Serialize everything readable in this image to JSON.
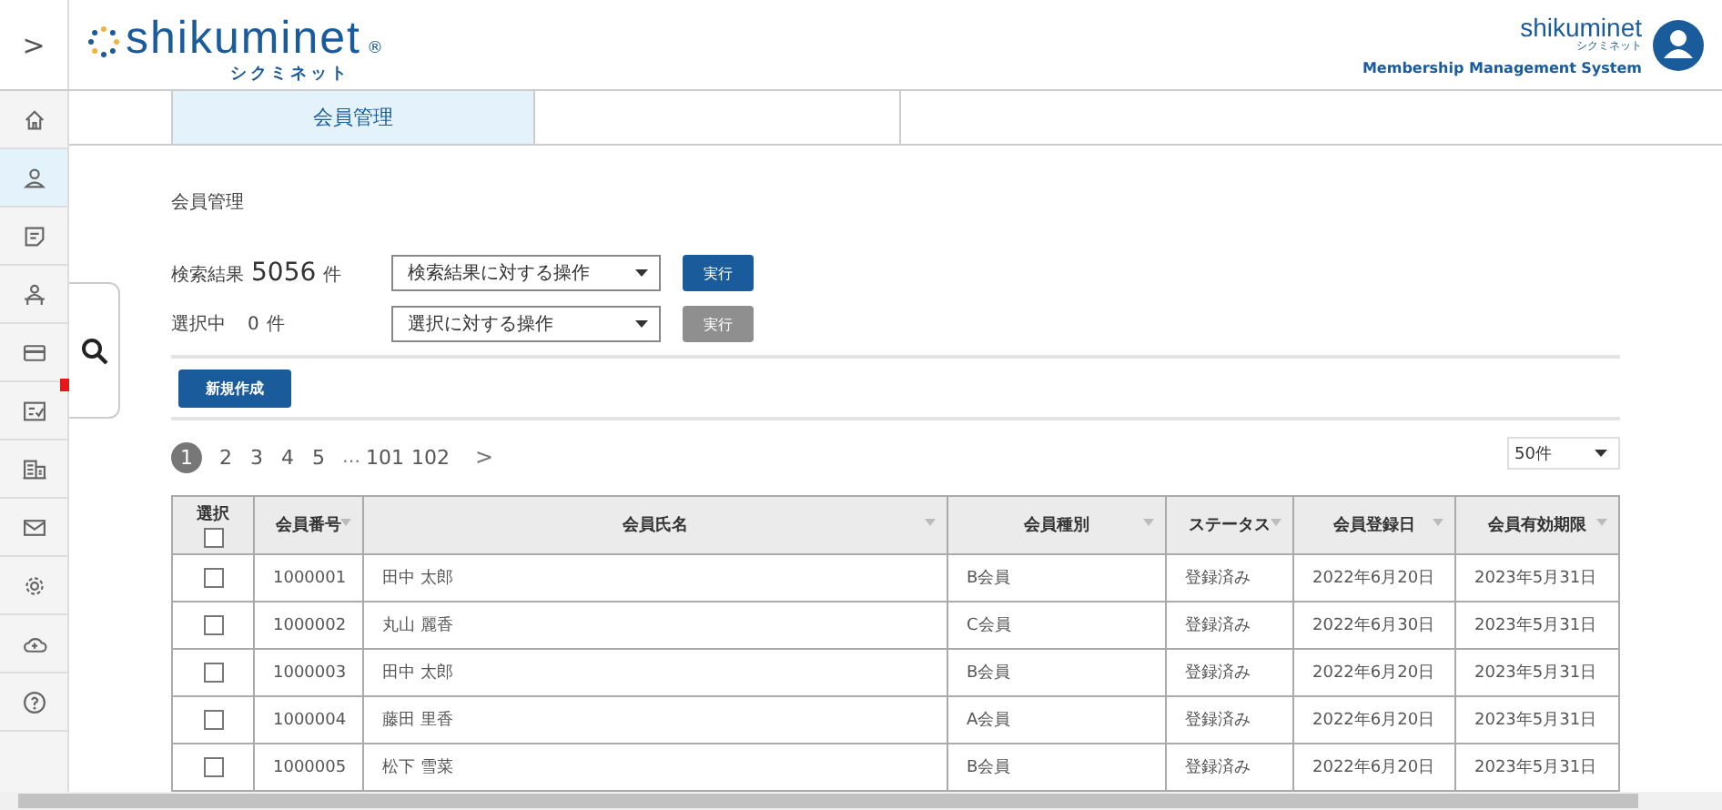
{
  "header": {
    "expand": ">",
    "logo": {
      "name": "shikuminet",
      "mark": "®",
      "kana": "シクミネット"
    },
    "brand": {
      "name": "shikuminet",
      "kana": "シクミネット",
      "tagline": "Membership Management System"
    }
  },
  "sidebar": {
    "items": [
      {
        "kind": "home",
        "selected": false,
        "alert": false
      },
      {
        "kind": "person",
        "selected": true,
        "alert": false
      },
      {
        "kind": "note",
        "selected": false,
        "alert": false
      },
      {
        "kind": "desk",
        "selected": false,
        "alert": false
      },
      {
        "kind": "card",
        "selected": false,
        "alert": false
      },
      {
        "kind": "checklist",
        "selected": false,
        "alert": true
      },
      {
        "kind": "building",
        "selected": false,
        "alert": false
      },
      {
        "kind": "mail",
        "selected": false,
        "alert": false
      },
      {
        "kind": "gear",
        "selected": false,
        "alert": false
      },
      {
        "kind": "cloud",
        "selected": false,
        "alert": false
      },
      {
        "kind": "help",
        "selected": false,
        "alert": false
      }
    ]
  },
  "tabs": [
    {
      "label": "会員管理",
      "selected": true
    }
  ],
  "page_title": "会員管理",
  "actions": [
    {
      "label": "検索結果",
      "count": "5056",
      "unit": "件",
      "emphasis": true,
      "select": {
        "value": "検索結果に対する操作"
      },
      "button": {
        "label": "実行",
        "disabled": false
      }
    },
    {
      "label": "選択中",
      "count": "0",
      "unit": "件",
      "emphasis": false,
      "select": {
        "value": "選択に対する操作"
      },
      "button": {
        "label": "実行",
        "disabled": true
      }
    }
  ],
  "new_button": "新規作成",
  "pagination": {
    "pages": [
      {
        "label": "1",
        "selected": true
      },
      {
        "label": "2",
        "selected": false
      },
      {
        "label": "3",
        "selected": false
      },
      {
        "label": "4",
        "selected": false
      },
      {
        "label": "5",
        "selected": false
      }
    ],
    "ellipsis": "…",
    "tail": [
      {
        "label": "101",
        "selected": false
      },
      {
        "label": "102",
        "selected": false
      }
    ],
    "next": ">"
  },
  "page_size": {
    "value": "50件"
  },
  "table": {
    "select_all": {
      "label": "選択",
      "checked": false
    },
    "columns": [
      "会員番号",
      "会員氏名",
      "会員種別",
      "ステータス",
      "会員登録日",
      "会員有効期限"
    ],
    "rows": [
      {
        "checked": false,
        "cells": [
          "1000001",
          "田中 太郎",
          "B会員",
          "登録済み",
          "2022年6月20日",
          "2023年5月31日"
        ]
      },
      {
        "checked": false,
        "cells": [
          "1000002",
          "丸山 麗香",
          "C会員",
          "登録済み",
          "2022年6月30日",
          "2023年5月31日"
        ]
      },
      {
        "checked": false,
        "cells": [
          "1000003",
          "田中 太郎",
          "B会員",
          "登録済み",
          "2022年6月20日",
          "2023年5月31日"
        ]
      },
      {
        "checked": false,
        "cells": [
          "1000004",
          "藤田 里香",
          "A会員",
          "登録済み",
          "2022年6月20日",
          "2023年5月31日"
        ]
      },
      {
        "checked": false,
        "cells": [
          "1000005",
          "松下 雪菜",
          "B会員",
          "登録済み",
          "2022年6月20日",
          "2023年5月31日"
        ]
      }
    ]
  }
}
